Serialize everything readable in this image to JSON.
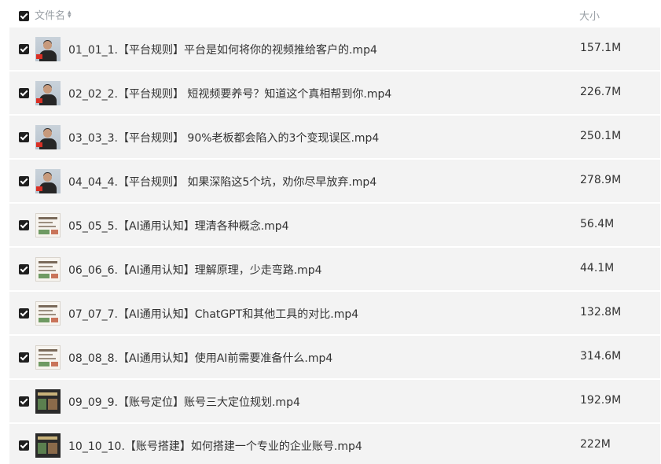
{
  "header": {
    "name_label": "文件名",
    "size_label": "大小"
  },
  "files": [
    {
      "name": "01_01_1.【平台规则】平台是如何将你的视频推给客户的.mp4",
      "size": "157.1M",
      "thumbnail": "person"
    },
    {
      "name": "02_02_2.【平台规则】 短视频要养号？知道这个真相帮到你.mp4",
      "size": "226.7M",
      "thumbnail": "person"
    },
    {
      "name": "03_03_3.【平台规则】 90%老板都会陷入的3个变现误区.mp4",
      "size": "250.1M",
      "thumbnail": "person"
    },
    {
      "name": "04_04_4.【平台规则】 如果深陷这5个坑，劝你尽早放弃.mp4",
      "size": "278.9M",
      "thumbnail": "person"
    },
    {
      "name": "05_05_5.【AI通用认知】理清各种概念.mp4",
      "size": "56.4M",
      "thumbnail": "slide"
    },
    {
      "name": "06_06_6.【AI通用认知】理解原理，少走弯路.mp4",
      "size": "44.1M",
      "thumbnail": "slide"
    },
    {
      "name": "07_07_7.【AI通用认知】ChatGPT和其他工具的对比.mp4",
      "size": "132.8M",
      "thumbnail": "slide"
    },
    {
      "name": "08_08_8.【AI通用认知】使用AI前需要准备什么.mp4",
      "size": "314.6M",
      "thumbnail": "slide"
    },
    {
      "name": "09_09_9.【账号定位】账号三大定位规划.mp4",
      "size": "192.9M",
      "thumbnail": "dark"
    },
    {
      "name": "10_10_10.【账号搭建】如何搭建一个专业的企业账号.mp4",
      "size": "222M",
      "thumbnail": "dark"
    }
  ],
  "colors": {
    "row_background": "#f3f3f3",
    "header_text": "#9aa0a6",
    "row_text": "#333333",
    "checkbox": "#1f1f1f"
  },
  "icons": [
    "checkbox-checked-icon",
    "sort-icon",
    "video-thumbnail-icon"
  ]
}
